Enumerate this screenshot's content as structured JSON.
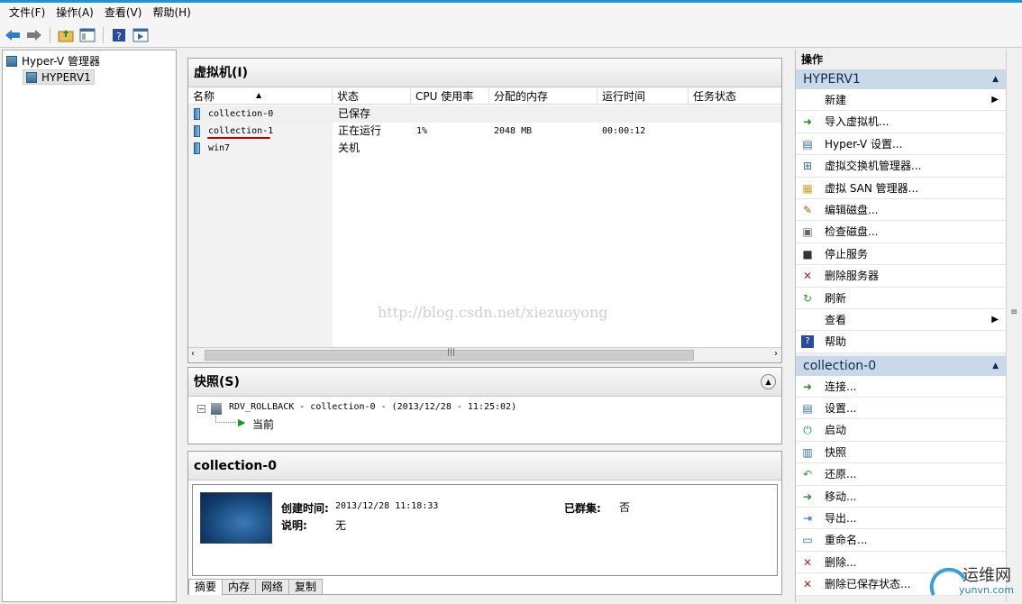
{
  "menu": [
    "文件(F)",
    "操作(A)",
    "查看(V)",
    "帮助(H)"
  ],
  "tree": {
    "root": "Hyper-V 管理器",
    "child": "HYPERV1"
  },
  "vm_panel": {
    "title": "虚拟机(I)",
    "columns": [
      "名称",
      "状态",
      "CPU 使用率",
      "分配的内存",
      "运行时间",
      "任务状态"
    ],
    "rows": [
      {
        "name": "collection-0",
        "state": "已保存",
        "cpu": "",
        "mem": "",
        "uptime": ""
      },
      {
        "name": "collection-1",
        "state": "正在运行",
        "cpu": "1%",
        "mem": "2048 MB",
        "uptime": "00:00:12"
      },
      {
        "name": "win7",
        "state": "关机",
        "cpu": "",
        "mem": "",
        "uptime": ""
      }
    ],
    "watermark": "http://blog.csdn.net/xiezuoyong"
  },
  "snapshot_panel": {
    "title": "快照(S)",
    "item": "RDV_ROLLBACK - collection-0 - (2013/12/28 - 11:25:02)",
    "current": "当前"
  },
  "detail_panel": {
    "title": "collection-0",
    "created_label": "创建时间:",
    "created_value": "2013/12/28 11:18:33",
    "cluster_label": "已群集:",
    "cluster_value": "否",
    "desc_label": "说明:",
    "desc_value": "无",
    "tabs": [
      "摘要",
      "内存",
      "网络",
      "复制"
    ]
  },
  "actions": {
    "title": "操作",
    "hyperv_section": "HYPERV1",
    "hyperv_items": [
      {
        "label": "新建",
        "icon": "none",
        "submenu": true
      },
      {
        "label": "导入虚拟机...",
        "icon": "import-icon"
      },
      {
        "label": "Hyper-V 设置...",
        "icon": "settings-icon"
      },
      {
        "label": "虚拟交换机管理器...",
        "icon": "switch-icon"
      },
      {
        "label": "虚拟 SAN 管理器...",
        "icon": "san-icon"
      },
      {
        "label": "编辑磁盘...",
        "icon": "edit-disk-icon"
      },
      {
        "label": "检查磁盘...",
        "icon": "inspect-disk-icon"
      },
      {
        "label": "停止服务",
        "icon": "stop-icon"
      },
      {
        "label": "删除服务器",
        "icon": "delete-icon"
      },
      {
        "label": "刷新",
        "icon": "refresh-icon"
      },
      {
        "label": "查看",
        "icon": "none",
        "submenu": true
      },
      {
        "label": "帮助",
        "icon": "help-icon"
      }
    ],
    "vm_section": "collection-0",
    "vm_items": [
      {
        "label": "连接...",
        "icon": "connect-icon"
      },
      {
        "label": "设置...",
        "icon": "settings-icon"
      },
      {
        "label": "启动",
        "icon": "power-icon"
      },
      {
        "label": "快照",
        "icon": "snapshot-icon"
      },
      {
        "label": "还原...",
        "icon": "revert-icon"
      },
      {
        "label": "移动...",
        "icon": "move-icon"
      },
      {
        "label": "导出...",
        "icon": "export-icon"
      },
      {
        "label": "重命名...",
        "icon": "rename-icon"
      },
      {
        "label": "删除...",
        "icon": "delete-icon"
      },
      {
        "label": "删除已保存状态...",
        "icon": "delete-state-icon"
      }
    ]
  },
  "logo": {
    "text": "运维网",
    "url": "yunvn.com"
  }
}
